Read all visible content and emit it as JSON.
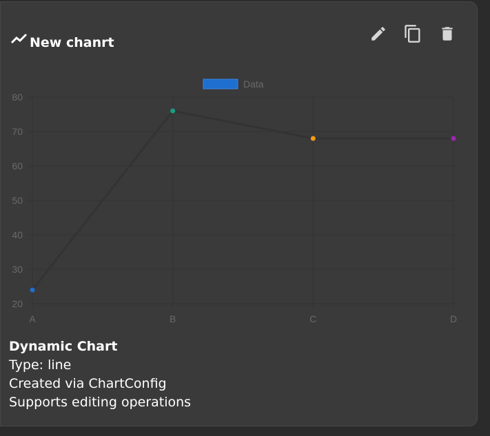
{
  "card": {
    "title": "New chanrt",
    "icons": {
      "title": "trend-line-icon",
      "edit": "pencil-icon",
      "copy": "copy-icon",
      "delete": "trash-icon"
    }
  },
  "info": {
    "heading": "Dynamic Chart",
    "type_line": "Type: line",
    "created_line": "Created via ChartConfig",
    "supports_line": "Supports editing operations"
  },
  "chart_data": {
    "type": "line",
    "categories": [
      "A",
      "B",
      "C",
      "D"
    ],
    "series": [
      {
        "name": "Data",
        "values": [
          24,
          76,
          68,
          68
        ],
        "legend_color": "#1e6fcf",
        "line_color": "#333333",
        "point_colors": [
          "#1e6fcf",
          "#16a085",
          "#f39c12",
          "#9b27b0"
        ]
      }
    ],
    "yticks": [
      20,
      30,
      40,
      50,
      60,
      70,
      80
    ],
    "ylim": [
      20,
      80
    ],
    "grid": true,
    "legend": "top-center"
  }
}
